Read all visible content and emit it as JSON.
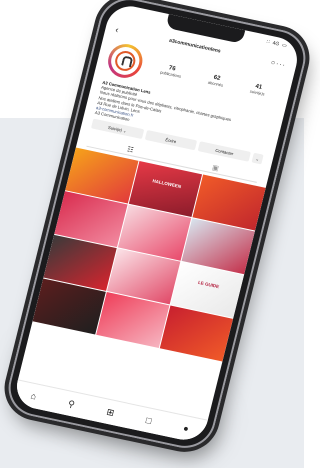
{
  "status": {
    "signal": "∷",
    "network": "4G",
    "battery": "▭"
  },
  "profile": {
    "username": "a3communicationlens",
    "stats": [
      {
        "value": "76",
        "label": "publications"
      },
      {
        "value": "62",
        "label": "abonnés"
      },
      {
        "value": "41",
        "label": "suivi(e)s"
      }
    ],
    "bio": {
      "name": "A3 Communication Lens",
      "lines": [
        "Agence de publicité",
        "Nous réalisons pour vous des dépliants, vitrophanie, chartes graphiques",
        "Nos ateliers dans le Pas-de-Calais",
        "A3 Rue de Liévin, Lens",
        "a3-communication.fr"
      ],
      "highlight": "A3 Communication"
    }
  },
  "actions": {
    "follow": "Suivi(e) ⌄",
    "message": "Écrire",
    "contact": "Contacter",
    "more": "⌄"
  },
  "posts": [
    {
      "label": "",
      "bg": "linear-gradient(135deg,#f6a21a,#e23b3b)",
      "light": false
    },
    {
      "label": "HALLOWEEN",
      "bg": "linear-gradient(160deg,#e63946,#8c1c2b)",
      "light": false
    },
    {
      "label": "",
      "bg": "linear-gradient(135deg,#f05a28,#c1272d)",
      "light": false
    },
    {
      "label": "",
      "bg": "linear-gradient(135deg,#d92d4f,#f28aa0)",
      "light": false
    },
    {
      "label": "",
      "bg": "linear-gradient(135deg,#f7d9df,#e94b6c)",
      "light": true
    },
    {
      "label": "",
      "bg": "linear-gradient(135deg,#d8e4ee,#c4314b)",
      "light": false
    },
    {
      "label": "",
      "bg": "linear-gradient(135deg,#3a3a3a,#d6242e)",
      "light": false
    },
    {
      "label": "",
      "bg": "linear-gradient(135deg,#fbe3e8,#e14a68)",
      "light": true
    },
    {
      "label": "LE GUIDE",
      "bg": "linear-gradient(135deg,#ffffff,#e9e9e9)",
      "light": true
    },
    {
      "label": "",
      "bg": "linear-gradient(135deg,#5b1e1e,#1f1f1f)",
      "light": false
    },
    {
      "label": "",
      "bg": "linear-gradient(135deg,#ef3f5a,#f6b4c0)",
      "light": false
    },
    {
      "label": "",
      "bg": "linear-gradient(135deg,#c8202f,#f05a28)",
      "light": false
    }
  ],
  "colors": {
    "accent": "#e8453c",
    "link": "#385185"
  }
}
